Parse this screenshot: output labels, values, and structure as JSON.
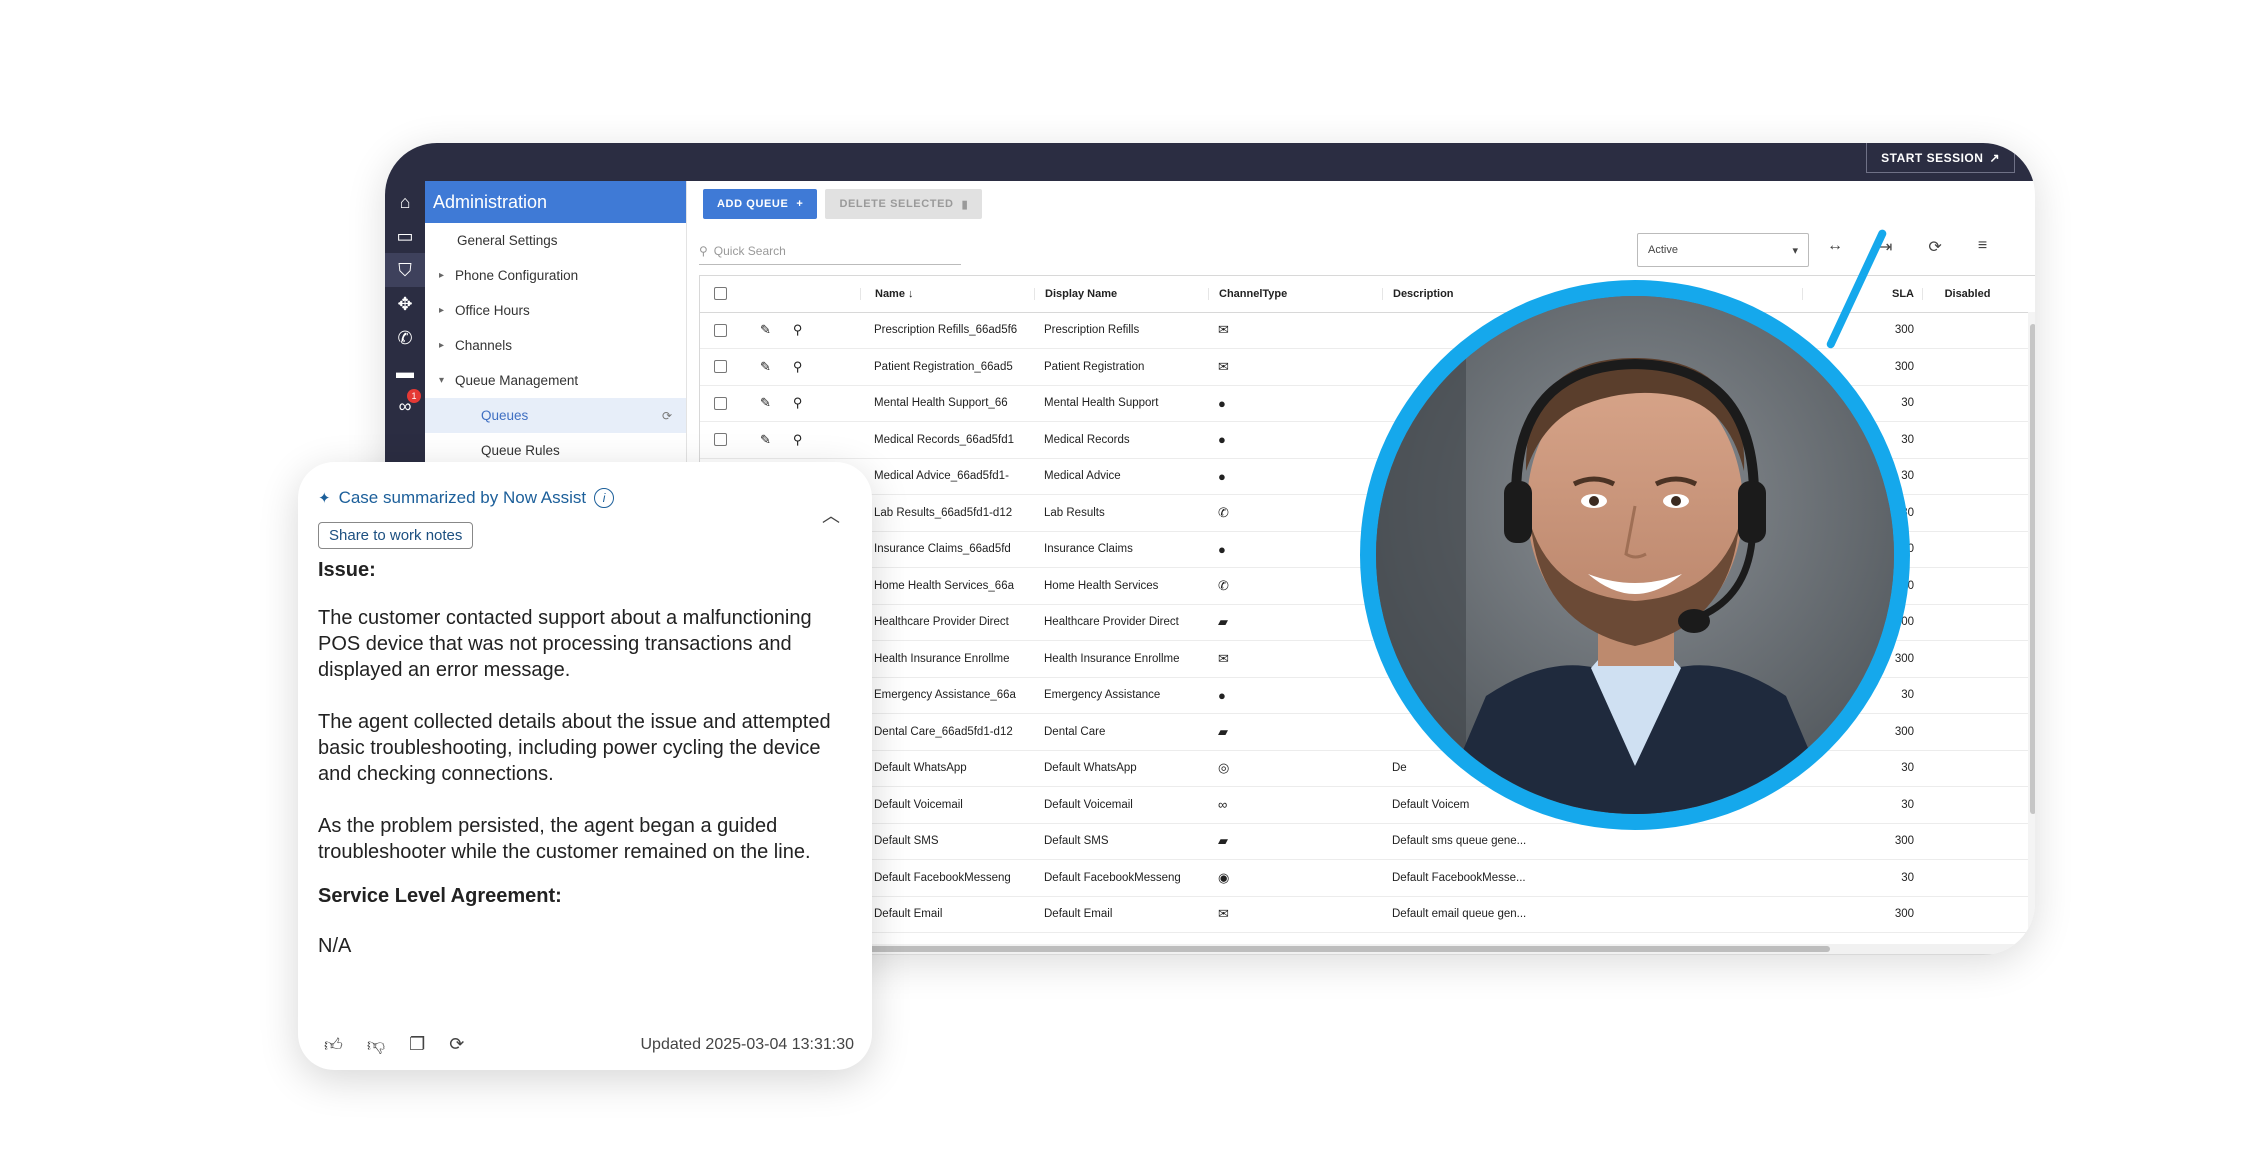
{
  "header": {
    "start_session": "START SESSION"
  },
  "nav_badge": "1",
  "sidebar": {
    "title": "Administration",
    "items": [
      {
        "label": "General Settings",
        "type": "plain"
      },
      {
        "label": "Phone Configuration",
        "type": "collapsed"
      },
      {
        "label": "Office Hours",
        "type": "collapsed"
      },
      {
        "label": "Channels",
        "type": "collapsed"
      },
      {
        "label": "Queue Management",
        "type": "expanded"
      },
      {
        "label": "Queues",
        "type": "child-selected"
      },
      {
        "label": "Queue Rules",
        "type": "child"
      }
    ]
  },
  "toolbar": {
    "add_queue": "ADD QUEUE",
    "delete_selected": "DELETE SELECTED"
  },
  "search": {
    "placeholder": "Quick Search"
  },
  "filter": {
    "status": "Active"
  },
  "table": {
    "columns": [
      "Name",
      "Display Name",
      "ChannelType",
      "Description",
      "SLA",
      "Disabled"
    ],
    "sort_indicator": "↓",
    "rows": [
      {
        "name": "Prescription Refills_66ad5f6",
        "display": "Prescription Refills",
        "channel": "email",
        "desc": "",
        "sla": "300"
      },
      {
        "name": "Patient Registration_66ad5",
        "display": "Patient Registration",
        "channel": "email",
        "desc": "",
        "sla": "300"
      },
      {
        "name": "Mental Health Support_66",
        "display": "Mental Health Support",
        "channel": "chat",
        "desc": "",
        "sla": "30"
      },
      {
        "name": "Medical Records_66ad5fd1",
        "display": "Medical Records",
        "channel": "chat",
        "desc": "",
        "sla": "30"
      },
      {
        "name": "Medical Advice_66ad5fd1-",
        "display": "Medical Advice",
        "channel": "chat",
        "desc": "",
        "sla": "30"
      },
      {
        "name": "Lab Results_66ad5fd1-d12",
        "display": "Lab Results",
        "channel": "phone",
        "desc": "",
        "sla": "30"
      },
      {
        "name": "Insurance Claims_66ad5fd",
        "display": "Insurance Claims",
        "channel": "chat",
        "desc": "",
        "sla": "30"
      },
      {
        "name": "Home Health Services_66a",
        "display": "Home Health Services",
        "channel": "phone",
        "desc": "",
        "sla": "30"
      },
      {
        "name": "Healthcare Provider Direct",
        "display": "Healthcare Provider Direct",
        "channel": "sms",
        "desc": "",
        "sla": "300"
      },
      {
        "name": "Health Insurance Enrollme",
        "display": "Health Insurance Enrollme",
        "channel": "email",
        "desc": "",
        "sla": "300"
      },
      {
        "name": "Emergency Assistance_66a",
        "display": "Emergency Assistance",
        "channel": "chat",
        "desc": "",
        "sla": "30"
      },
      {
        "name": "Dental Care_66ad5fd1-d12",
        "display": "Dental Care",
        "channel": "sms",
        "desc": "",
        "sla": "300"
      },
      {
        "name": "Default WhatsApp",
        "display": "Default WhatsApp",
        "channel": "whatsapp",
        "desc": "De",
        "sla": "30"
      },
      {
        "name": "Default Voicemail",
        "display": "Default Voicemail",
        "channel": "voicemail",
        "desc": "Default Voicem",
        "sla": "30"
      },
      {
        "name": "Default SMS",
        "display": "Default SMS",
        "channel": "sms",
        "desc": "Default sms queue gene...",
        "sla": "300"
      },
      {
        "name": "Default FacebookMesseng",
        "display": "Default FacebookMesseng",
        "channel": "messenger",
        "desc": "Default FacebookMesse...",
        "sla": "30"
      },
      {
        "name": "Default Email",
        "display": "Default Email",
        "channel": "email",
        "desc": "Default email queue gen...",
        "sla": "300"
      }
    ]
  },
  "summary": {
    "title": "Case summarized by Now Assist",
    "share_label": "Share to work notes",
    "issue_heading": "Issue:",
    "paragraphs": [
      "The customer contacted support about a malfunctioning POS device that was not processing transactions and displayed an error message.",
      "The agent collected details about the issue and attempted basic troubleshooting, including power cycling the device and checking connections.",
      "As the problem persisted, the agent began a guided troubleshooter while the customer remained on the line."
    ],
    "sla_heading": "Service Level Agreement:",
    "sla_value": "N/A",
    "updated": "Updated 2025-03-04 13:31:30"
  }
}
